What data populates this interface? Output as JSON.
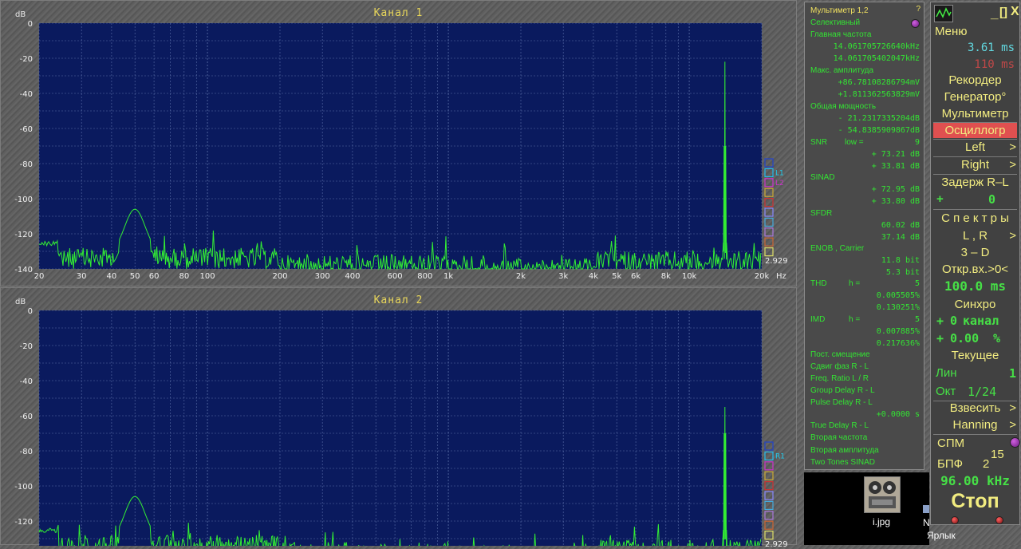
{
  "colors": {
    "plot_bg": "#0a1a5e",
    "grid": "#5a6ea8",
    "trace": "#33ee33",
    "title": "#e8d65a"
  },
  "common": {
    "db_unit": "dB",
    "hz_unit": "Hz",
    "side_value": "2.929",
    "y_ticks": [
      "0",
      "-20",
      "-40",
      "-60",
      "-80",
      "-100",
      "-120",
      "-140"
    ],
    "x_tick_labels": [
      {
        "f": 20,
        "t": "20"
      },
      {
        "f": 30,
        "t": "30"
      },
      {
        "f": 40,
        "t": "40"
      },
      {
        "f": 50,
        "t": "50"
      },
      {
        "f": 60,
        "t": "60"
      },
      {
        "f": 80,
        "t": "80"
      },
      {
        "f": 100,
        "t": "100"
      },
      {
        "f": 200,
        "t": "200"
      },
      {
        "f": 300,
        "t": "300"
      },
      {
        "f": 400,
        "t": "400"
      },
      {
        "f": 600,
        "t": "600"
      },
      {
        "f": 800,
        "t": "800"
      },
      {
        "f": 1000,
        "t": "1k"
      },
      {
        "f": 2000,
        "t": "2k"
      },
      {
        "f": 3000,
        "t": "3k"
      },
      {
        "f": 4000,
        "t": "4k"
      },
      {
        "f": 5000,
        "t": "5k"
      },
      {
        "f": 6000,
        "t": "6k"
      },
      {
        "f": 8000,
        "t": "8k"
      },
      {
        "f": 10000,
        "t": "10k"
      },
      {
        "f": 20000,
        "t": "20k"
      }
    ],
    "legend_box_colors": [
      "#2244cc",
      "#22bbee",
      "#cc33cc",
      "#ccaa33",
      "#cc3333",
      "#8888ff",
      "#44aadd",
      "#aa77dd",
      "#cc6633",
      "#dddd66"
    ]
  },
  "channel1": {
    "title": "Канал 1",
    "legend_labels": [
      "L1",
      "L2"
    ],
    "legend_label_colors": [
      "#22ccee",
      "#cc33cc"
    ]
  },
  "channel2": {
    "title": "Канал 2",
    "legend_labels": [
      "R1"
    ],
    "legend_label_colors": [
      "#22ccee"
    ]
  },
  "multimeter": {
    "title": "Мультиметр 1,2",
    "help": "?",
    "mode": "Селективный",
    "main_freq_label": "Главная частота",
    "main_freq_1": "14.061705726640",
    "main_freq_2": "14.061705402047",
    "freq_unit": "kHz",
    "max_amp_label": "Макс. амплитуда",
    "max_amp_1": "+86.78108286794",
    "max_amp_2": "+1.811362563829",
    "amp_unit": "mV",
    "power_label": "Общая мощность",
    "power_1": "- 21.2317335204",
    "power_2": "- 54.8385909867",
    "db": "dB",
    "snr_label": "SNR",
    "snr_low": "low =",
    "snr_low_val": "9",
    "snr_1": "+ 73.21",
    "snr_2": "+ 33.81",
    "sinad_label": "SINAD",
    "sinad_1": "+ 72.95",
    "sinad_2": "+ 33.80",
    "sfdr_label": "SFDR",
    "sfdr_1": "60.02",
    "sfdr_2": "37.14",
    "enob_label": "ENOB , Carrier",
    "enob_1": "11.8",
    "enob_2": "5.3",
    "bit": "bit",
    "thd_label": "THD",
    "thd_h": "h =",
    "thd_h_val": "5",
    "thd_1": "0.005505",
    "thd_2": "0.130251",
    "imd_label": "IMD",
    "imd_h": "h =",
    "imd_h_val": "5",
    "imd_1": "0.007885",
    "imd_2": "0.217636",
    "percent": "%",
    "dc_label": "Пост. смещение",
    "phase_label": "Сдвиг фаз R - L",
    "ratio_label": "Freq. Ratio  L / R",
    "group_label": "Group Delay R - L",
    "pulse_label": "Pulse Delay R - L",
    "pulse_val": "+0.0000",
    "s": "s",
    "true_label": "True Delay R - L",
    "second_freq_label": "Вторая частота",
    "second_amp_label": "Вторая амплитуда",
    "two_tones_label": "Two Tones SINAD"
  },
  "control": {
    "min_btn": "_",
    "max_btn": "[]",
    "close_btn": "X",
    "menu": "Меню",
    "t1": "3.61",
    "t2": "110",
    "ms": "ms",
    "recorder": "Рекордер",
    "generator": "Генератор°",
    "multimeter": "Мультиметр",
    "oscilloscope": "Осциллогр",
    "left": "Left",
    "right": "Right",
    "arrow": ">",
    "delay": "Задерж  R–L",
    "delay_sign": "+",
    "delay_val": "0",
    "spectra": "С п е к т р ы",
    "lr": "L , R",
    "threed": "3 – D",
    "open_in": "Откр.вх.>0<",
    "open_val": "100.0",
    "sync": "Синхро",
    "sync_sign1": "+",
    "sync_ch_val": "0",
    "sync_ch": "канал",
    "sync_sign2": "+",
    "sync_pct": "0.00",
    "pct": "%",
    "current": "Текущее",
    "lin": "Лин",
    "lin_val": "1",
    "oct": "Окт",
    "oct_val": "1/24",
    "weigh": "Взвесить",
    "window": "Hanning",
    "spm": "СПМ",
    "fft": "БПФ",
    "fft_base": "2",
    "fft_exp": "15",
    "rate": "96.00",
    "khz": "kHz",
    "stop": "Стоп"
  },
  "desktop": {
    "file1": "i.jpg",
    "file2": "Ярлык",
    "partial": "N"
  }
}
